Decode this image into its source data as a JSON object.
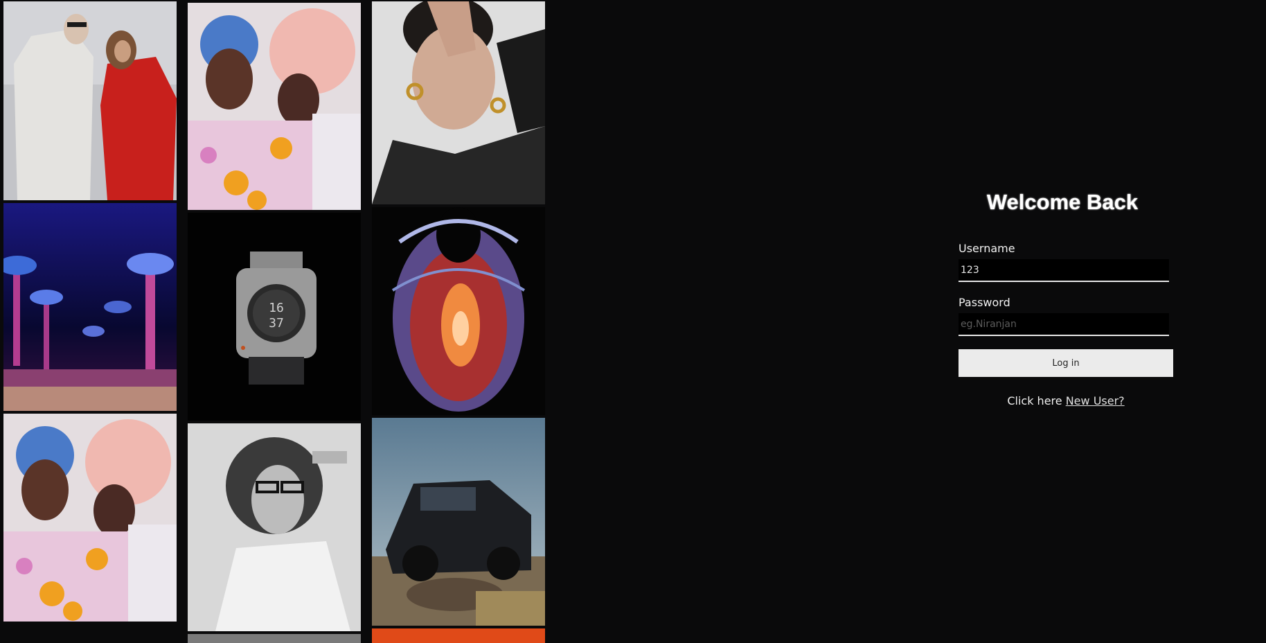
{
  "login": {
    "title": "Welcome Back",
    "username_label": "Username",
    "username_value": "123",
    "password_label": "Password",
    "password_placeholder": "eg.Niranjan",
    "login_button": "Log in",
    "footer_text": "Click here",
    "new_user_link": "New User?"
  },
  "gallery": {
    "photos": [
      "two-women-coats-photo",
      "bubble-hair-portrait-photo",
      "hand-over-face-portrait-photo",
      "neon-mushroom-landscape-photo",
      "square-watch-photo",
      "chrome-mesh-face-photo",
      "bubble-hair-portrait-photo-2",
      "woman-glasses-bw-photo",
      "black-suv-rocks-photo",
      "grey-texture-photo",
      "orange-photo"
    ]
  },
  "colors": {
    "background": "#0a0a0b",
    "button_bg": "#ebebeb",
    "input_bg": "#000000",
    "text": "#ffffff"
  }
}
